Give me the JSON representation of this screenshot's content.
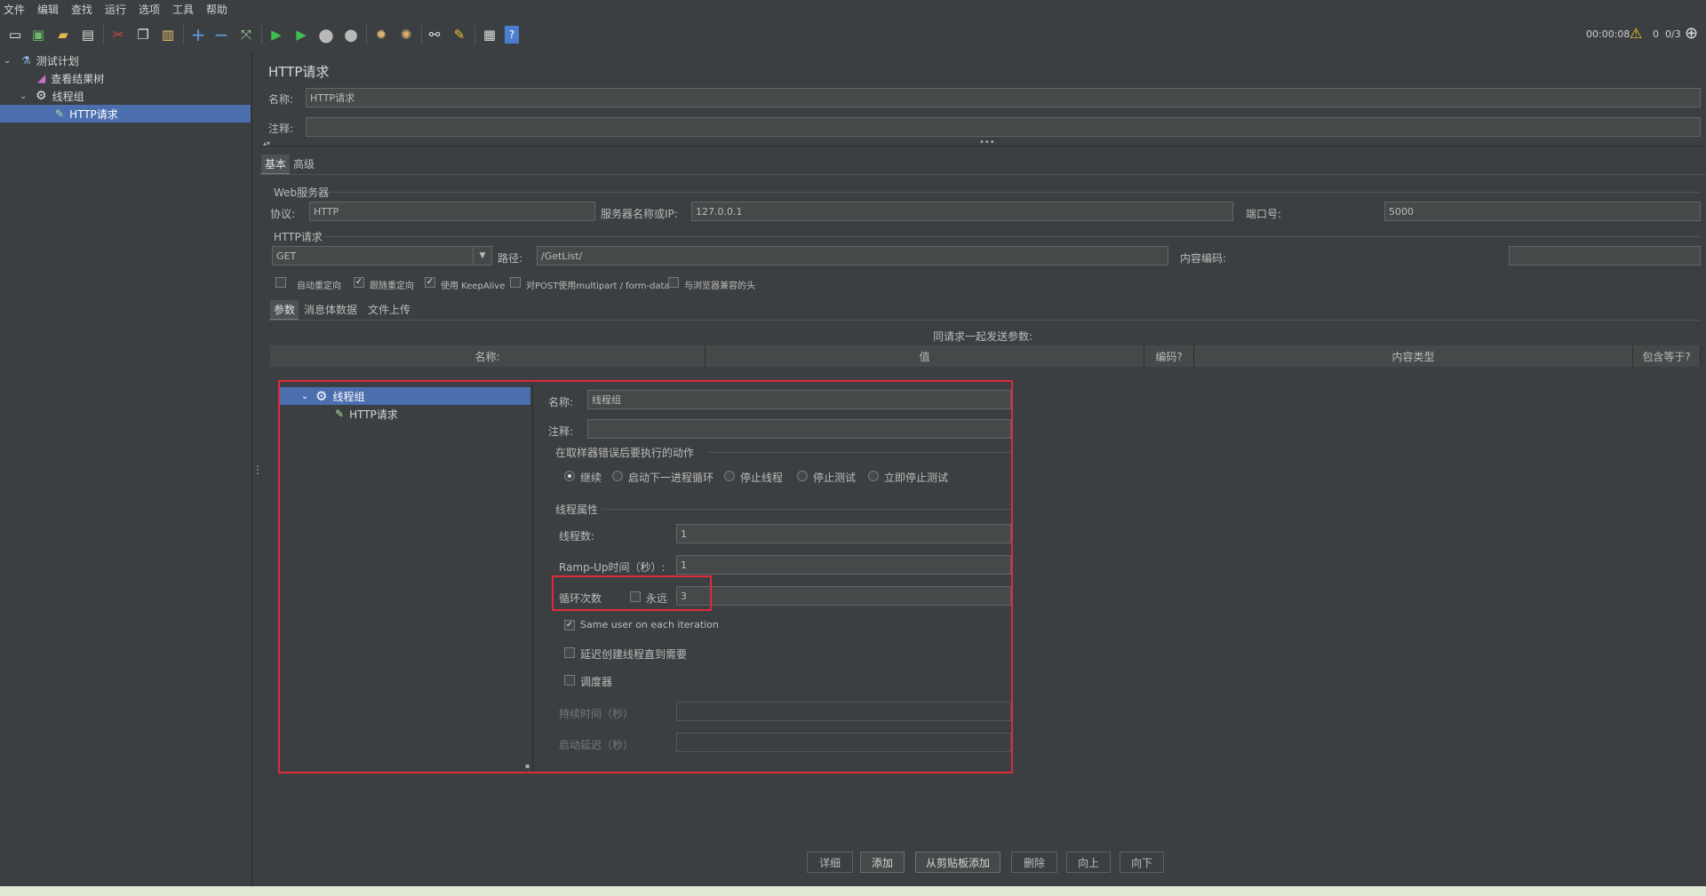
{
  "menu": [
    "文件",
    "编辑",
    "查找",
    "运行",
    "选项",
    "工具",
    "帮助"
  ],
  "toolbar": {
    "icons": [
      "new-icon",
      "templates-icon",
      "open-icon",
      "save-icon",
      "cut-icon",
      "copy-icon",
      "paste-icon",
      "expand-icon",
      "collapse-icon",
      "toggle-icon",
      "start-icon",
      "start-no-pause-icon",
      "stop-icon",
      "shutdown-icon",
      "clear-icon",
      "clear-all-icon",
      "search-icon",
      "reset-search-icon",
      "function-helper-icon",
      "help-icon"
    ],
    "timer": "00:00:08",
    "warnings": "0",
    "threads": "0/3"
  },
  "tree": [
    {
      "label": "测试计划",
      "icon": "flask-icon",
      "indent": 0,
      "expanded": true
    },
    {
      "label": "查看结果树",
      "icon": "chart-icon",
      "indent": 1
    },
    {
      "label": "线程组",
      "icon": "gear-icon",
      "indent": 1,
      "expanded": true
    },
    {
      "label": "HTTP请求",
      "icon": "pipette-icon",
      "indent": 2,
      "selected": true
    }
  ],
  "http": {
    "panel_title": "HTTP请求",
    "name_label": "名称:",
    "name_value": "HTTP请求",
    "comment_label": "注释:",
    "comment_value": "",
    "tabs": [
      "基本",
      "高级"
    ],
    "web_server_title": "Web服务器",
    "protocol_label": "协议:",
    "protocol_value": "HTTP",
    "server_label": "服务器名称或IP:",
    "server_value": "127.0.0.1",
    "port_label": "端口号:",
    "port_value": "5000",
    "request_title": "HTTP请求",
    "method_value": "GET",
    "path_label": "路径:",
    "path_value": "/GetList/",
    "encoding_label": "内容编码:",
    "encoding_value": "",
    "options": [
      {
        "label": "自动重定向",
        "checked": false
      },
      {
        "label": "跟随重定向",
        "checked": true
      },
      {
        "label": "使用 KeepAlive",
        "checked": true
      },
      {
        "label": "对POST使用multipart / form-data",
        "checked": false
      },
      {
        "label": "与浏览器兼容的头",
        "checked": false
      }
    ],
    "sub_tabs": [
      "参数",
      "消息体数据",
      "文件上传"
    ],
    "params_caption": "同请求一起发送参数:",
    "columns": [
      "名称:",
      "值",
      "编码?",
      "内容类型",
      "包含等于?"
    ],
    "buttons": [
      {
        "label": "详细",
        "enabled": false
      },
      {
        "label": "添加",
        "enabled": true
      },
      {
        "label": "从剪贴板添加",
        "enabled": true
      },
      {
        "label": "删除",
        "enabled": false
      },
      {
        "label": "向上",
        "enabled": false
      },
      {
        "label": "向下",
        "enabled": false
      }
    ]
  },
  "overlay": {
    "tree": [
      {
        "label": "线程组",
        "icon": "gear-icon",
        "selected": true
      },
      {
        "label": "HTTP请求",
        "icon": "pipette-icon"
      }
    ],
    "name_label": "名称:",
    "name_value": "线程组",
    "comment_label": "注释:",
    "comment_value": "",
    "error_title": "在取样器错误后要执行的动作",
    "error_actions": [
      {
        "label": "继续",
        "selected": true
      },
      {
        "label": "启动下一进程循环",
        "selected": false
      },
      {
        "label": "停止线程",
        "selected": false
      },
      {
        "label": "停止测试",
        "selected": false
      },
      {
        "label": "立即停止测试",
        "selected": false
      }
    ],
    "props_title": "线程属性",
    "threads_label": "线程数:",
    "threads_value": "1",
    "rampup_label": "Ramp-Up时间（秒）:",
    "rampup_value": "1",
    "loop_label": "循环次数",
    "forever_label": "永远",
    "loop_value": "3",
    "same_user_label": "Same user on each iteration",
    "delay_label": "延迟创建线程直到需要",
    "scheduler_label": "调度器",
    "duration_label": "持续时间（秒）",
    "startup_delay_label": "启动延迟（秒）"
  },
  "colors": {
    "accent_selection": "#4b6eaf",
    "highlight": "#e02a3a",
    "background": "#3c3f41"
  }
}
